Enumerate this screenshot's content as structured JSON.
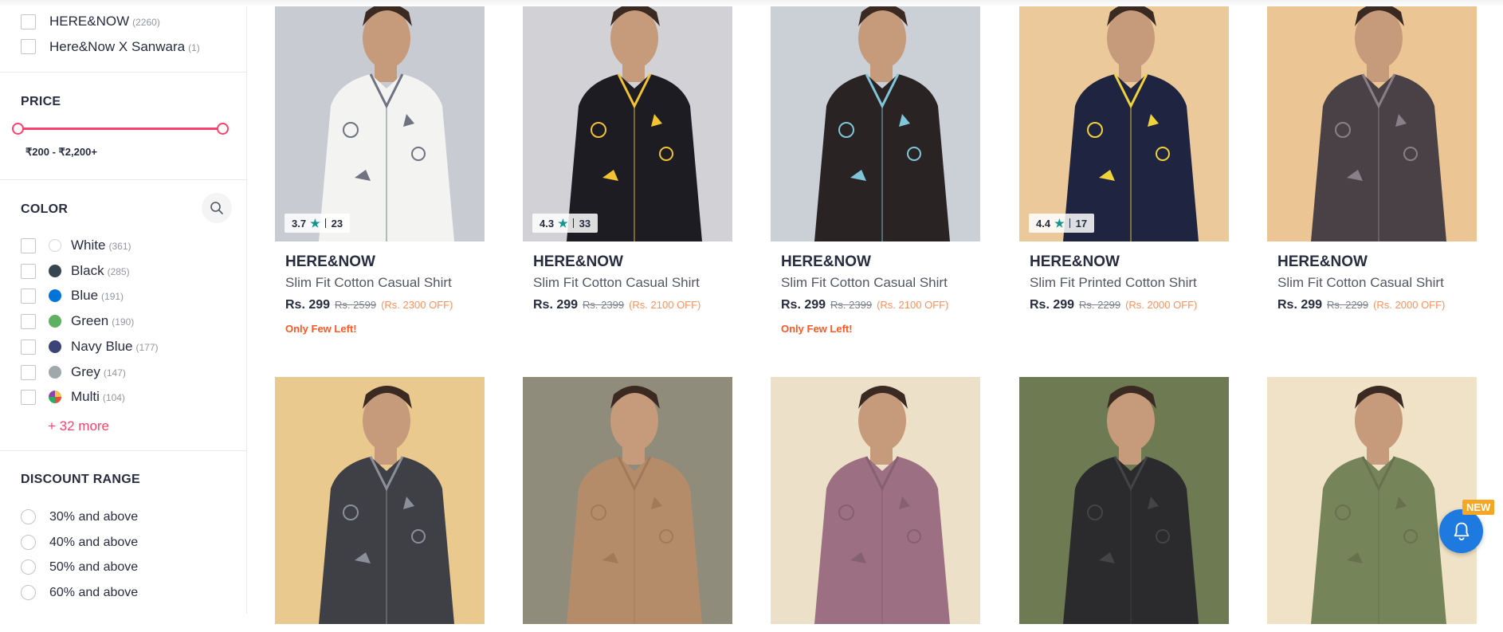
{
  "brand_filter": {
    "items": [
      {
        "label": "HERE&NOW",
        "count": "(2260)"
      },
      {
        "label": "Here&Now X Sanwara",
        "count": "(1)"
      }
    ]
  },
  "price_filter": {
    "title": "PRICE",
    "range_text": "₹200 - ₹2,200+",
    "accent": "#ff3f6c"
  },
  "color_filter": {
    "title": "COLOR",
    "search_icon": "search-icon",
    "items": [
      {
        "label": "White",
        "count": "(361)",
        "color": "#ffffff"
      },
      {
        "label": "Black",
        "count": "(285)",
        "color": "#36454f"
      },
      {
        "label": "Blue",
        "count": "(191)",
        "color": "#0074d9"
      },
      {
        "label": "Green",
        "count": "(190)",
        "color": "#5eb160"
      },
      {
        "label": "Navy Blue",
        "count": "(177)",
        "color": "#3c4477"
      },
      {
        "label": "Grey",
        "count": "(147)",
        "color": "#9fa8ab"
      },
      {
        "label": "Multi",
        "count": "(104)",
        "color": "multi"
      }
    ],
    "more": "+ 32 more"
  },
  "discount_filter": {
    "title": "DISCOUNT RANGE",
    "options": [
      "30% and above",
      "40% and above",
      "50% and above",
      "60% and above"
    ]
  },
  "products": [
    {
      "rating": "3.7",
      "rating_count": "23",
      "brand": "HERE&NOW",
      "name": "Slim Fit Cotton Casual Shirt",
      "price": "Rs. 299",
      "mrp": "Rs. 2599",
      "discount": "(Rs. 2300 OFF)",
      "note": "Only Few Left!",
      "image_bg": "#c9cbd3",
      "shirt": "#f3f3f1",
      "pattern": "#6f7280"
    },
    {
      "rating": "4.3",
      "rating_count": "33",
      "brand": "HERE&NOW",
      "name": "Slim Fit Cotton Casual Shirt",
      "price": "Rs. 299",
      "mrp": "Rs. 2399",
      "discount": "(Rs. 2100 OFF)",
      "note": "",
      "image_bg": "#d2d2d6",
      "shirt": "#1c1c22",
      "pattern": "#f2c230"
    },
    {
      "rating": "",
      "rating_count": "",
      "brand": "HERE&NOW",
      "name": "Slim Fit Cotton Casual Shirt",
      "price": "Rs. 299",
      "mrp": "Rs. 2399",
      "discount": "(Rs. 2100 OFF)",
      "note": "Only Few Left!",
      "image_bg": "#cbcfd6",
      "shirt": "#2a2324",
      "pattern": "#7fc7d8"
    },
    {
      "rating": "4.4",
      "rating_count": "17",
      "brand": "HERE&NOW",
      "name": "Slim Fit Printed Cotton Shirt",
      "price": "Rs. 299",
      "mrp": "Rs. 2299",
      "discount": "(Rs. 2000 OFF)",
      "note": "",
      "image_bg": "#ecc99a",
      "shirt": "#1f2440",
      "pattern": "#f0d23a"
    },
    {
      "rating": "",
      "rating_count": "",
      "brand": "HERE&NOW",
      "name": "Slim Fit Cotton Casual Shirt",
      "price": "Rs. 299",
      "mrp": "Rs. 2299",
      "discount": "(Rs. 2000 OFF)",
      "note": "",
      "image_bg": "#ecc594",
      "shirt": "#4a4146",
      "pattern": "#8a7f86"
    },
    {
      "image_bg": "#e9c98e",
      "shirt": "#3f4045",
      "pattern": "#8c8f99"
    },
    {
      "image_bg": "#8f8c7c",
      "shirt": "#b58c6a",
      "pattern": "#a07a5a"
    },
    {
      "image_bg": "#ede0c8",
      "shirt": "#9c6f82",
      "pattern": "#85606f"
    },
    {
      "image_bg": "#6d7a52",
      "shirt": "#2b2b2d",
      "pattern": "#444447"
    },
    {
      "image_bg": "#efe2c6",
      "shirt": "#76845a",
      "pattern": "#66724d"
    }
  ],
  "notification": {
    "badge": "NEW",
    "icon": "bell-icon"
  }
}
